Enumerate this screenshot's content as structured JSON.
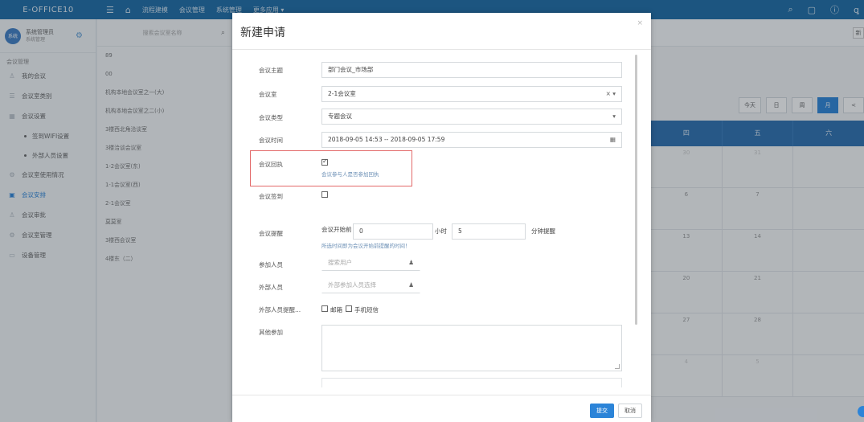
{
  "app": {
    "brand": "E-OFFICE10",
    "nav": [
      "流程建模",
      "会议管理",
      "系统管理",
      "更多应用 ▾"
    ]
  },
  "icons": {
    "menu": "menu-icon",
    "home": "home-icon",
    "search": "search-icon",
    "chat": "chat-icon",
    "info": "info-icon",
    "user": "user-icon"
  },
  "user": {
    "avatar": "系统",
    "name": "系统管理员",
    "role": "系统管理"
  },
  "sidebar": {
    "section": "会议管理",
    "items": [
      {
        "label": "我的会议",
        "icon": "person-icon",
        "sub": false,
        "active": false
      },
      {
        "label": "会议室类别",
        "icon": "list-icon",
        "sub": false,
        "active": false
      },
      {
        "label": "会议设置",
        "icon": "grid-icon",
        "sub": false,
        "active": false
      },
      {
        "label": "签到WIFI设置",
        "icon": "dot-icon",
        "sub": true,
        "active": false
      },
      {
        "label": "外部人员设置",
        "icon": "dot-icon",
        "sub": true,
        "active": false
      },
      {
        "label": "会议室使用情况",
        "icon": "gear-icon",
        "sub": false,
        "active": false
      },
      {
        "label": "会议安排",
        "icon": "calendar-icon",
        "sub": false,
        "active": true
      },
      {
        "label": "会议审批",
        "icon": "person-icon",
        "sub": false,
        "active": false
      },
      {
        "label": "会议室管理",
        "icon": "gear-icon",
        "sub": false,
        "active": false
      },
      {
        "label": "设备管理",
        "icon": "device-icon",
        "sub": false,
        "active": false
      }
    ]
  },
  "rooms": {
    "search_placeholder": "搜索会议室名称",
    "list": [
      "89",
      "00",
      "机构本地会议室之一(大)",
      "机构本地会议室之二(小)",
      "3楼西北角洽谈室",
      "3楼洽谈会议室",
      "1-2会议室(东)",
      "1-1会议室(西)",
      "2-1会议室",
      "莫莫室",
      "3楼西会议室",
      "4楼东（二）"
    ]
  },
  "calendar": {
    "view_buttons": [
      "今天",
      "日",
      "周",
      "月"
    ],
    "active_view": "月",
    "prev": "<",
    "next": "新",
    "weekdays": [
      "四",
      "五",
      "六"
    ],
    "rows": [
      [
        "30",
        "31",
        ""
      ],
      [
        "6",
        "7",
        ""
      ],
      [
        "13",
        "14",
        ""
      ],
      [
        "20",
        "21",
        ""
      ],
      [
        "27",
        "28",
        ""
      ],
      [
        "4",
        "5",
        ""
      ]
    ]
  },
  "modal": {
    "title": "新建申请",
    "close": "×",
    "labels": {
      "subject": "会议主题",
      "room": "会议室",
      "type": "会议类型",
      "time": "会议时间",
      "receipt": "会议回执",
      "signin": "会议签到",
      "reminder": "会议提醒",
      "participants": "参加人员",
      "external": "外部人员",
      "external_remind": "外部人员提醒...",
      "others": "其他参加"
    },
    "values": {
      "subject": "部门会议_市场部",
      "room": "2-1会议室",
      "room_suffix": "× ▾",
      "type": "专题会议",
      "type_suffix": "▾",
      "time": "2018-09-05 14:53 -- 2018-09-05 17:59"
    },
    "receipt_note": "会议参与人是否参加回执",
    "receipt_checked": true,
    "signin_checked": false,
    "reminder": {
      "before_label": "会议开始前",
      "hours_value": "0",
      "hours_unit": "小时",
      "minutes_value": "5",
      "minutes_unit": "分钟提醒",
      "note": "所选时间即为会议开始前提醒的时间！"
    },
    "participants_placeholder": "搜索用户",
    "external_placeholder": "外部参加人员选择",
    "external_remind_options": [
      {
        "label": "邮箱",
        "checked": false
      },
      {
        "label": "手机短信",
        "checked": false
      }
    ],
    "submit": "提交",
    "cancel": "取消"
  }
}
